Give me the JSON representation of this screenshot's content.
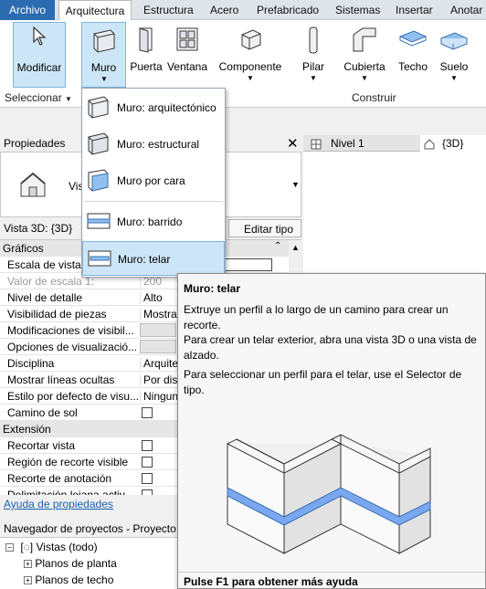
{
  "menubar": {
    "tabs": [
      "Archivo",
      "Arquitectura",
      "Estructura",
      "Acero",
      "Prefabricado",
      "Sistemas",
      "Insertar",
      "Anotar"
    ]
  },
  "ribbon": {
    "buttons": {
      "modify": "Modificar",
      "wall": "Muro",
      "door": "Puerta",
      "window": "Ventana",
      "component": "Componente",
      "column": "Pilar",
      "roof": "Cubierta",
      "ceiling": "Techo",
      "floor": "Suelo"
    },
    "panels": {
      "select": "Seleccionar",
      "build": "Construir"
    }
  },
  "wall_menu": {
    "items": [
      "Muro: arquitectónico",
      "Muro: estructural",
      "Muro por cara",
      "Muro: barrido",
      "Muro: telar"
    ],
    "selected": "Muro: telar"
  },
  "properties": {
    "title": "Propiedades",
    "type_label_partial": "Vis",
    "view_selector": "Vista 3D: {3D}",
    "edit_type": "Editar tipo",
    "rows": [
      {
        "group": "Gráficos"
      },
      {
        "key": "Escala de vista",
        "value": ""
      },
      {
        "key": "Valor de escala    1:",
        "value": "200",
        "greyed": true
      },
      {
        "key": "Nivel de detalle",
        "value": "Alto"
      },
      {
        "key": "Visibilidad de piezas",
        "value": "Mostrar"
      },
      {
        "key": "Modificaciones de visibil...",
        "value": ""
      },
      {
        "key": "Opciones de visualizació...",
        "value": ""
      },
      {
        "key": "Disciplina",
        "value": "Arquite"
      },
      {
        "key": "Mostrar líneas ocultas",
        "value": "Por disc"
      },
      {
        "key": "Estilo por defecto de visu...",
        "value": "Ningun"
      },
      {
        "key": "Camino de sol",
        "value": ""
      },
      {
        "group": "Extensión"
      },
      {
        "key": "Recortar vista",
        "value": ""
      },
      {
        "key": "Región de recorte visible",
        "value": ""
      },
      {
        "key": "Recorte de anotación",
        "value": ""
      },
      {
        "key": "Delimitación lejana activ...",
        "value": ""
      }
    ],
    "help_link": "Ayuda de propiedades"
  },
  "project_browser": {
    "title": "Navegador de proyectos - Proyecto",
    "nodes": [
      "Vistas (todo)",
      "Planos de planta",
      "Planos de techo"
    ]
  },
  "view_tabs": [
    "Nivel 1",
    "{3D}"
  ],
  "tooltip": {
    "title": "Muro: telar",
    "p1": "Extruye un perfil a lo largo de un camino para crear un recorte.",
    "p2": "Para crear un telar exterior, abra una vista 3D o una vista de alzado.",
    "p3": "Para seleccionar un perfil para el telar, use el Selector de tipo.",
    "footer": "Pulse F1 para obtener más ayuda"
  },
  "colors": {
    "accent": "#2b6cb0",
    "selected_bg": "#cde6f7",
    "sweep_blue": "#7aa7f0"
  }
}
